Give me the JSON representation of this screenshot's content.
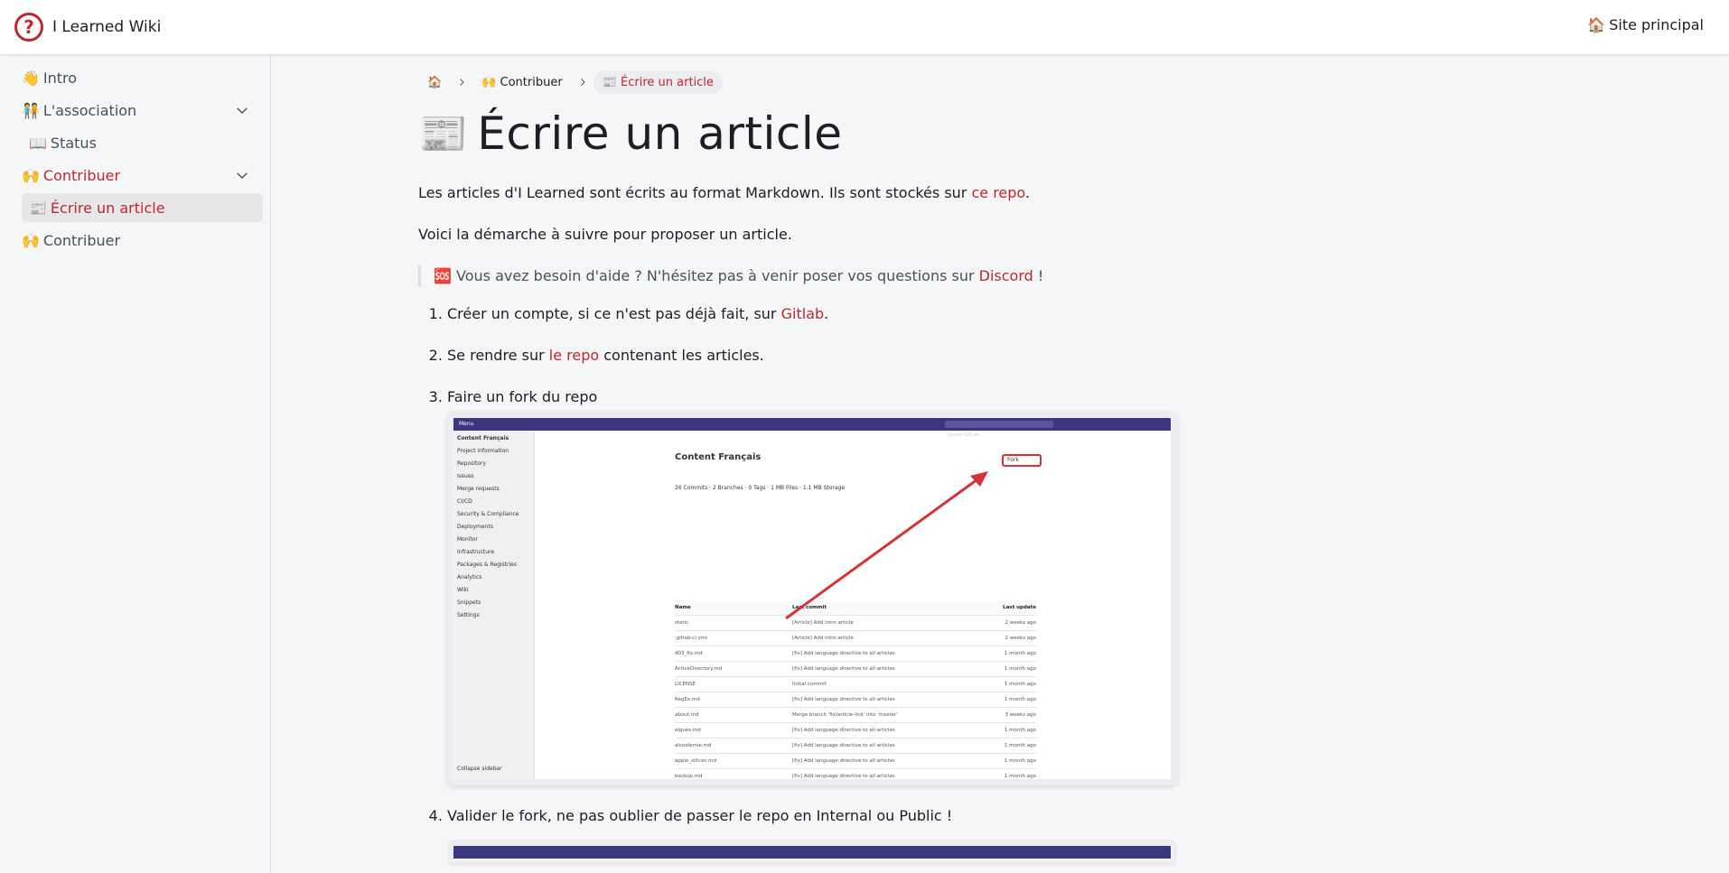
{
  "navbar": {
    "brand": "I Learned Wiki",
    "site_link": "Site principal",
    "site_emoji": "🏠"
  },
  "sidebar": {
    "items": [
      {
        "emoji": "👋",
        "label": "Intro"
      },
      {
        "emoji": "🧑‍🤝‍🧑",
        "label": "L'association"
      },
      {
        "emoji": "📖",
        "label": "Status"
      },
      {
        "emoji": "🙌",
        "label": "Contribuer"
      },
      {
        "emoji": "📰",
        "label": "Écrire un article"
      },
      {
        "emoji": "🙌",
        "label": "Contribuer"
      }
    ]
  },
  "breadcrumb": {
    "home_emoji": "🏠",
    "level1_emoji": "🙌",
    "level1": "Contribuer",
    "current_emoji": "📰",
    "current": "Écrire un article"
  },
  "article": {
    "title_emoji": "📰",
    "title": "Écrire un article",
    "p1_before": "Les articles d'I Learned sont écrits au format Markdown. Ils sont stockés sur ",
    "p1_link": "ce repo",
    "p1_after": ".",
    "p2": "Voici la démarche à suivre pour proposer un article.",
    "callout_emoji": "🆘",
    "callout_before": " Vous avez besoin d'aide ? N'hésitez pas à venir poser vos questions sur ",
    "callout_link": "Discord",
    "callout_after": " !",
    "steps": [
      {
        "before": "Créer un compte, si ce n'est pas déjà fait, sur ",
        "link": "Gitlab",
        "after": "."
      },
      {
        "before": "Se rendre sur ",
        "link": "le repo",
        "after": " contenant les articles."
      },
      {
        "text": "Faire un fork du repo"
      },
      {
        "text": "Valider le fork, ne pas oublier de passer le repo en Internal ou Public !"
      }
    ]
  },
  "screenshot": {
    "menu": "Menu",
    "search": "Search GitLab",
    "sidebar_header": "Content Français",
    "sidebar": [
      "Project information",
      "Repository",
      "Issues",
      "Merge requests",
      "CI/CD",
      "Security & Compliance",
      "Deployments",
      "Monitor",
      "Infrastructure",
      "Packages & Registries",
      "Analytics",
      "Wiki",
      "Snippets",
      "Settings"
    ],
    "collapse": "Collapse sidebar",
    "project_title": "Content Français",
    "fork": "Fork",
    "stats": "26 Commits  ·  2 Branches  ·  0 Tags  ·  1 MB Files  ·  1.1 MB Storage",
    "table_head": [
      "Name",
      "Last commit",
      "Last update"
    ],
    "rows": [
      [
        "static",
        "[Article] Add intro article",
        "2 weeks ago"
      ],
      [
        ".gitlab-ci.yml",
        "[Article] Add intro article",
        "2 weeks ago"
      ],
      [
        "403_fix.md",
        "[fix] Add language directive to all articles",
        "1 month ago"
      ],
      [
        "ActiveDirectory.md",
        "[fix] Add language directive to all articles",
        "1 month ago"
      ],
      [
        "LICENSE",
        "Initial commit",
        "1 month ago"
      ],
      [
        "RegEx.md",
        "[fix] Add language directive to all articles",
        "1 month ago"
      ],
      [
        "about.md",
        "Merge branch 'fix/article-link' into 'master'",
        "3 weeks ago"
      ],
      [
        "algues.md",
        "[fix] Add language directive to all articles",
        "1 month ago"
      ],
      [
        "alcoolemie.md",
        "[fix] Add language directive to all articles",
        "1 month ago"
      ],
      [
        "apple_silicon.md",
        "[fix] Add language directive to all articles",
        "1 month ago"
      ],
      [
        "backup.md",
        "[fix] Add language directive to all articles",
        "1 month ago"
      ]
    ]
  },
  "colors": {
    "accent": "#c0262d",
    "gitlab_top": "#3b3680"
  }
}
